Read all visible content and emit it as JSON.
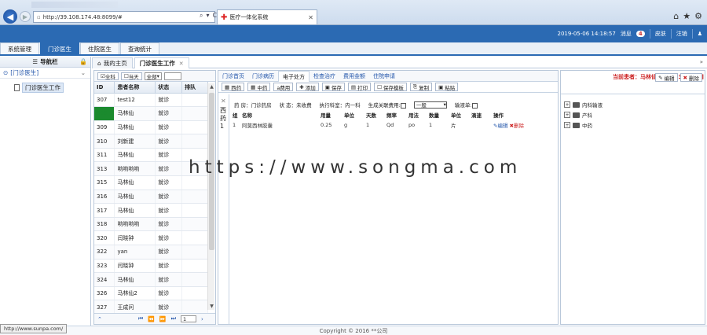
{
  "browser": {
    "url": "http://39.108.174.48:8099/#",
    "tab_title": "医疗一体化系统",
    "tools": [
      "⌕",
      "▾",
      "C"
    ]
  },
  "header": {
    "datetime": "2019-05-06 14:18:57",
    "messages_label": "消息",
    "messages_count": "4",
    "theme_label": "皮肤",
    "logout_label": "注销"
  },
  "main_nav": [
    "系统管理",
    "门诊医生",
    "住院医生",
    "查询统计"
  ],
  "main_nav_active": 1,
  "left_panel": {
    "title": "导航栏",
    "group": "[门诊医生]",
    "leaf": "门诊医生工作"
  },
  "content_tabs": {
    "home": "我的主页",
    "work": "门诊医生工作"
  },
  "patient_list": {
    "all_label": "全科",
    "today_label": "当天",
    "filter_value": "全部",
    "columns": [
      "ID",
      "患者名称",
      "状态",
      "排队"
    ],
    "rows": [
      {
        "id": "307",
        "name": "test12",
        "status": "就诊",
        "queue": ""
      },
      {
        "id": "308",
        "name": "马林仙",
        "status": "就诊",
        "queue": ""
      },
      {
        "id": "309",
        "name": "马林仙",
        "status": "就诊",
        "queue": ""
      },
      {
        "id": "310",
        "name": "刘新建",
        "status": "就诊",
        "queue": ""
      },
      {
        "id": "311",
        "name": "马林仙",
        "status": "就诊",
        "queue": ""
      },
      {
        "id": "313",
        "name": "哟哟哟哟",
        "status": "就诊",
        "queue": ""
      },
      {
        "id": "315",
        "name": "马林仙",
        "status": "就诊",
        "queue": ""
      },
      {
        "id": "316",
        "name": "马林仙",
        "status": "就诊",
        "queue": ""
      },
      {
        "id": "317",
        "name": "马林仙",
        "status": "就诊",
        "queue": ""
      },
      {
        "id": "318",
        "name": "哟哟哟哟",
        "status": "就诊",
        "queue": ""
      },
      {
        "id": "320",
        "name": "闫晓钟",
        "status": "就诊",
        "queue": ""
      },
      {
        "id": "322",
        "name": "yan",
        "status": "就诊",
        "queue": ""
      },
      {
        "id": "323",
        "name": "闫晓钟",
        "status": "就诊",
        "queue": ""
      },
      {
        "id": "324",
        "name": "马林仙",
        "status": "就诊",
        "queue": ""
      },
      {
        "id": "326",
        "name": "马林仙2",
        "status": "就诊",
        "queue": ""
      },
      {
        "id": "327",
        "name": "王成问",
        "status": "就诊",
        "queue": ""
      }
    ],
    "pager": {
      "page": "1"
    }
  },
  "rx": {
    "tabs": [
      "门诊首页",
      "门诊病历",
      "电子处方",
      "检查治疗",
      "费用金额",
      "住院申请"
    ],
    "active_tab": 2,
    "patient_label": "当前患者：马林仙[17012300002]",
    "toolbar": [
      "西药",
      "中药",
      "a费用",
      "添加",
      "保存",
      "打印",
      "保存模板",
      "复制",
      "粘贴"
    ],
    "side_label": "西药1",
    "info": {
      "pharmacy": "药 房：门诊药房",
      "status": "状 态：未收费",
      "dept": "执行科室：内一科",
      "fee_label": "生成关联费用:",
      "type_value": "一般",
      "infusion_label": "输液单:"
    },
    "columns": [
      "组",
      "名称",
      "用量",
      "单位",
      "天数",
      "频率",
      "用法",
      "数量",
      "单位",
      "滴速",
      "操作"
    ],
    "rows": [
      {
        "group": "1",
        "name": "阿莫西林胶囊",
        "dose": "0.25",
        "unit": "g",
        "days": "1",
        "freq": "Qd",
        "route": "po",
        "qty": "1",
        "qty_unit": "片",
        "drip": "",
        "edit": "编辑",
        "delete": "删除"
      }
    ]
  },
  "tree": {
    "edit_label": "编辑",
    "delete_label": "删除",
    "nodes": [
      "内科输液",
      "产科",
      "中药"
    ]
  },
  "footer": {
    "copyright": "Copyright © 2016   **公司",
    "status_url": "http://www.sunpa.com/"
  },
  "watermark": "https://www.songma.com",
  "colors": {
    "brand": "#2b6ab3",
    "highlight": "#1b8a2e",
    "alert": "#cc2222"
  }
}
